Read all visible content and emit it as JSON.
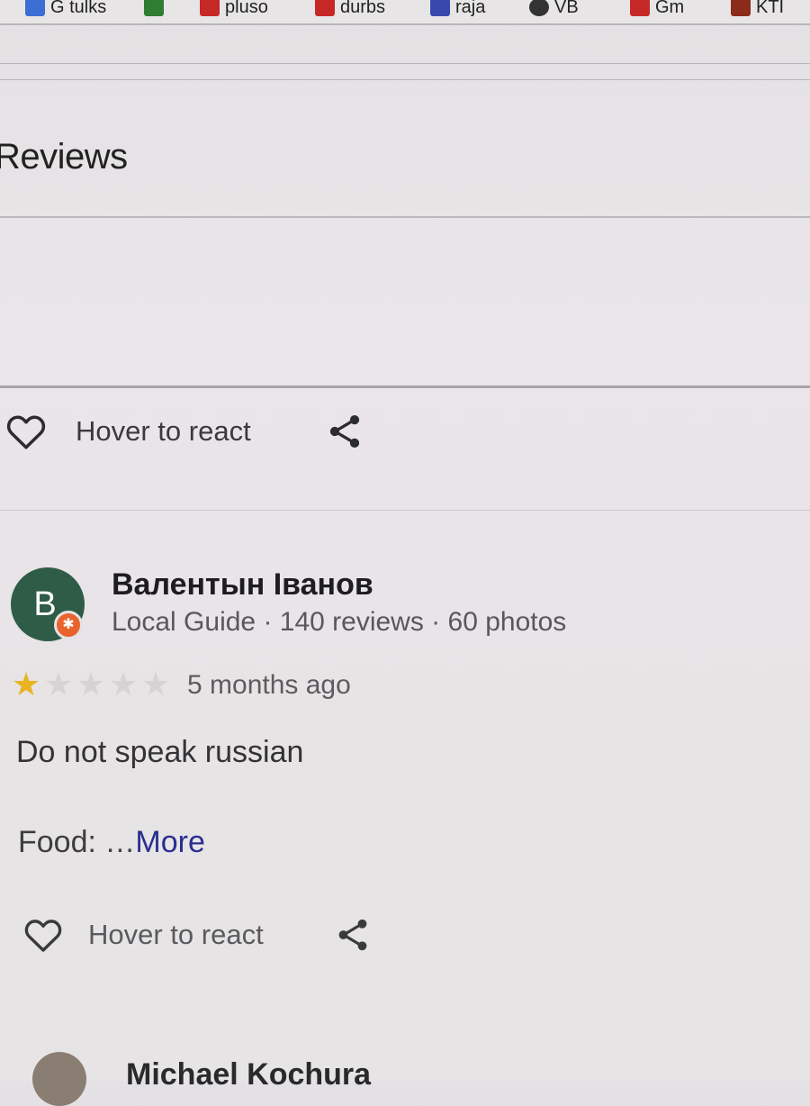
{
  "bookmarks": [
    {
      "label": "G tulks",
      "icon": "google-translate-icon",
      "color": "#3b6fd4"
    },
    {
      "label": "",
      "icon": "bookmark-icon",
      "color": "#2e7d32"
    },
    {
      "label": "pluso",
      "icon": "gmail-icon",
      "color": "#c62828"
    },
    {
      "label": "durbs",
      "icon": "bookmark-icon",
      "color": "#c62828"
    },
    {
      "label": "raja",
      "icon": "bookmark-icon",
      "color": "#3949ab"
    },
    {
      "label": "VB",
      "icon": "bookmark-icon",
      "color": "#333333"
    },
    {
      "label": "Gm",
      "icon": "bookmark-icon",
      "color": "#c62828"
    },
    {
      "label": "KTI",
      "icon": "bookmark-icon",
      "color": "#8d2b1a"
    }
  ],
  "section": {
    "title": "Reviews"
  },
  "react_row_1": {
    "label": "Hover to react"
  },
  "review": {
    "avatar_letter": "B",
    "reviewer_name": "Валентын Іванов",
    "reviewer_meta": "Local Guide · 140 reviews · 60 photos",
    "rating": 1,
    "rating_max": 5,
    "date": "5 months ago",
    "text": "Do not speak russian",
    "food_label": "Food: …",
    "more_label": "More",
    "react_label": "Hover to react"
  },
  "next_review": {
    "reviewer_name": "Michael Kochura"
  },
  "colors": {
    "avatar_bg": "#2e5c46",
    "local_guide_badge": "#e8642c",
    "star_filled": "#e9b422",
    "star_empty": "#d6d3d5",
    "link": "#2a2f8f"
  }
}
